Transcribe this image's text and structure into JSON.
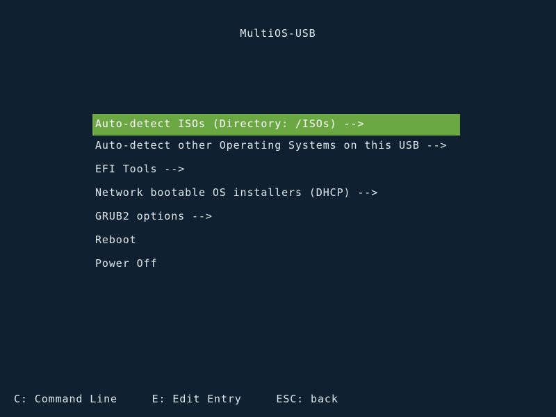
{
  "screen": {
    "background_color": "#0f2030",
    "text_color": "#dfe7ec",
    "highlight_color": "#6ba843",
    "highlight_text_color": "#ffffff"
  },
  "title": "MultiOS-USB",
  "menu": {
    "selected_index": 0,
    "items": [
      {
        "label": "Auto-detect ISOs (Directory: /ISOs) -->",
        "selected": true
      },
      {
        "label": "Auto-detect other Operating Systems on this USB -->",
        "selected": false
      },
      {
        "label": "EFI Tools -->",
        "selected": false
      },
      {
        "label": "Network bootable OS installers (DHCP) -->",
        "selected": false
      },
      {
        "label": "GRUB2 options -->",
        "selected": false
      },
      {
        "label": "Reboot",
        "selected": false
      },
      {
        "label": "Power Off",
        "selected": false
      }
    ]
  },
  "footer": {
    "items": [
      {
        "label": "C: Command Line"
      },
      {
        "label": "E: Edit Entry"
      },
      {
        "label": "ESC: back"
      }
    ],
    "separator": "     "
  }
}
